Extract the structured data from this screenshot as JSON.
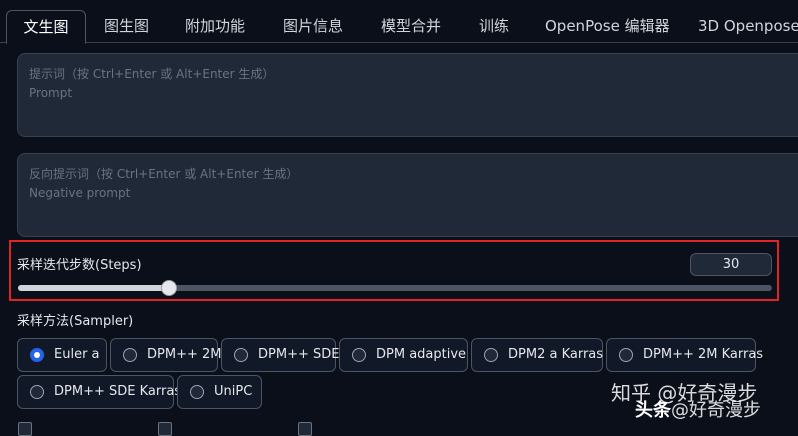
{
  "tabs": [
    {
      "label": "文生图",
      "active": true
    },
    {
      "label": "图生图"
    },
    {
      "label": "附加功能"
    },
    {
      "label": "图片信息"
    },
    {
      "label": "模型合并"
    },
    {
      "label": "训练"
    },
    {
      "label": "OpenPose 编辑器"
    },
    {
      "label": "3D Openpose"
    }
  ],
  "prompt": {
    "hint": "提示词（按 Ctrl+Enter 或 Alt+Enter 生成）",
    "placeholder": "Prompt"
  },
  "negative_prompt": {
    "hint": "反向提示词（按 Ctrl+Enter 或 Alt+Enter 生成）",
    "placeholder": "Negative prompt"
  },
  "steps": {
    "label": "采样迭代步数(Steps)",
    "value": "30",
    "fraction": 0.2
  },
  "sampler": {
    "label": "采样方法(Sampler)",
    "options": [
      {
        "label": "Euler a",
        "checked": true
      },
      {
        "label": "DPM++ 2M"
      },
      {
        "label": "DPM++ SDE"
      },
      {
        "label": "DPM adaptive"
      },
      {
        "label": "DPM2 a Karras"
      },
      {
        "label": "DPM++ 2M Karras"
      },
      {
        "label": "DPM++ SDE Karras"
      },
      {
        "label": "UniPC"
      }
    ]
  },
  "watermark": {
    "line1": "知乎 @好奇漫步",
    "brand": "头条",
    "line2": "@好奇漫步"
  },
  "colors": {
    "accent": "#2563eb",
    "highlight_frame": "#e02424"
  }
}
